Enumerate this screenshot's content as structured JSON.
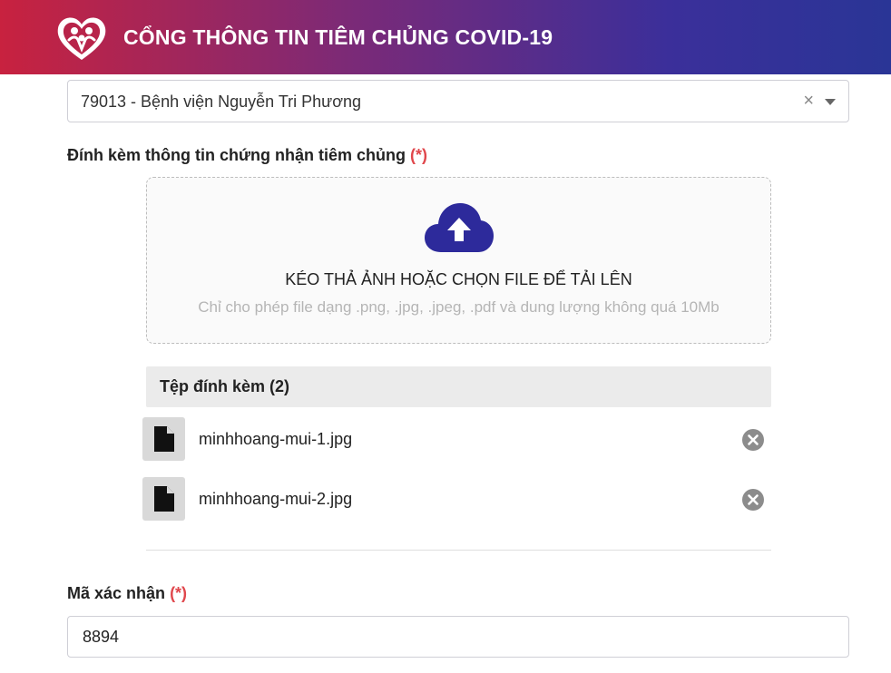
{
  "header": {
    "title": "CỔNG THÔNG TIN TIÊM CHỦNG COVID-19",
    "logo_icon": "heart-people-logo-icon"
  },
  "facility_select": {
    "value": "79013 - Bệnh viện Nguyễn Tri Phương",
    "clear_symbol": "×"
  },
  "attachment_section": {
    "label": "Đính kèm thông tin chứng nhận tiêm chủng",
    "required_mark": "(*)"
  },
  "dropzone": {
    "title": "KÉO THẢ ẢNH HOẶC CHỌN FILE ĐỂ TẢI LÊN",
    "hint": "Chỉ cho phép file dạng .png, .jpg, .jpeg, .pdf và dung lượng không quá 10Mb",
    "icon": "cloud-upload-icon",
    "accent_color": "#2d2a9b"
  },
  "attachments": {
    "header": "Tệp đính kèm (2)",
    "files": [
      {
        "name": "minhhoang-mui-1.jpg"
      },
      {
        "name": "minhhoang-mui-2.jpg"
      }
    ]
  },
  "captcha": {
    "label": "Mã xác nhận",
    "required_mark": "(*)",
    "value": "8894"
  },
  "colors": {
    "header_start": "#c8223f",
    "header_end": "#2a3596",
    "required": "#e0474c"
  }
}
